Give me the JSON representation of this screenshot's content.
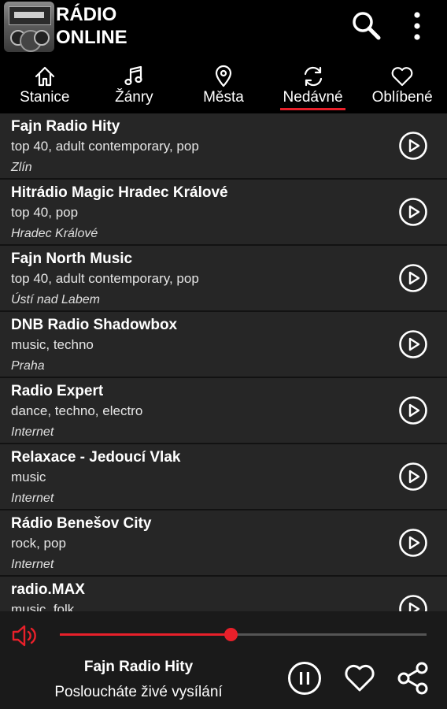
{
  "header": {
    "title_line1": "RÁDIO",
    "title_line2": "ONLINE",
    "search_icon": "search-icon",
    "menu_icon": "more-vertical-icon"
  },
  "tabs": [
    {
      "label": "Stanice",
      "icon": "home-icon",
      "active": false
    },
    {
      "label": "Žánry",
      "icon": "music-note-icon",
      "active": false
    },
    {
      "label": "Města",
      "icon": "location-pin-icon",
      "active": false
    },
    {
      "label": "Nedávné",
      "icon": "refresh-icon",
      "active": true
    },
    {
      "label": "Oblíbené",
      "icon": "heart-icon",
      "active": false
    }
  ],
  "stations": [
    {
      "name": "Fajn Radio Hity",
      "genres": "top 40, adult contemporary, pop",
      "city": "Zlín"
    },
    {
      "name": "Hitrádio Magic Hradec Králové",
      "genres": "top 40, pop",
      "city": "Hradec Králové"
    },
    {
      "name": "Fajn North Music",
      "genres": "top 40, adult contemporary, pop",
      "city": "Ústí nad Labem"
    },
    {
      "name": "DNB Radio Shadowbox",
      "genres": "music, techno",
      "city": "Praha"
    },
    {
      "name": "Radio Expert",
      "genres": "dance, techno, electro",
      "city": "Internet"
    },
    {
      "name": "Relaxace - Jedoucí Vlak",
      "genres": "music",
      "city": "Internet"
    },
    {
      "name": "Rádio Benešov City",
      "genres": "rock, pop",
      "city": "Internet"
    },
    {
      "name": "radio.MAX",
      "genres": "music, folk",
      "city": ""
    }
  ],
  "player": {
    "title": "Fajn Radio Hity",
    "subtitle": "Posloucháte živé vysílání",
    "volume_fraction": 0.465,
    "accent": "#e8202a"
  }
}
